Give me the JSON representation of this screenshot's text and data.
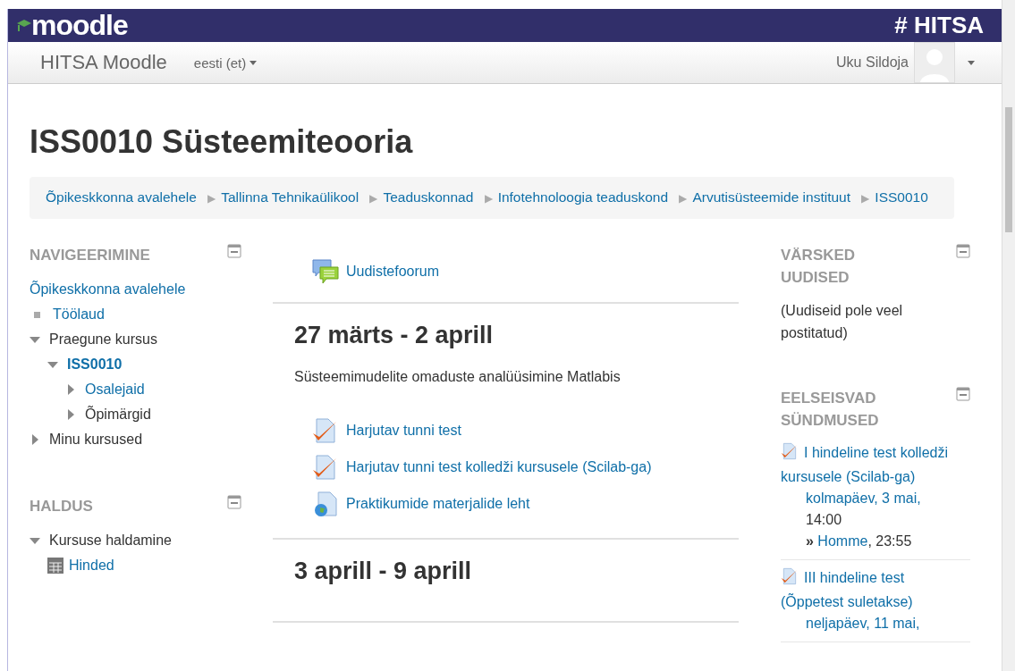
{
  "brand": {
    "logo": "moodle",
    "partner_mark": "#",
    "partner": "HITSA"
  },
  "breadcrumb_separator": "▶",
  "navbar": {
    "site_name": "HITSA Moodle",
    "language": "eesti (et)",
    "user_name": "Uku Sildoja"
  },
  "page_title": "ISS0010 Süsteemiteooria",
  "breadcrumb": [
    "Õpikeskkonna avalehele",
    "Tallinna Tehnikaülikool",
    "Teaduskonnad",
    "Infotehnoloogia teaduskond",
    "Arvutisüsteemide instituut",
    "ISS0010"
  ],
  "left_blocks": [
    {
      "title": "NAVIGEERIMINE",
      "items": [
        {
          "label": "Õpikeskkonna avalehele",
          "kind": "root",
          "link": true
        },
        {
          "label": "Töölaud",
          "kind": "leaf",
          "link": true
        },
        {
          "label": "Praegune kursus",
          "kind": "branch",
          "expanded": true,
          "link": false,
          "children": [
            {
              "label": "ISS0010",
              "kind": "branch",
              "expanded": true,
              "link": true,
              "current": true,
              "children": [
                {
                  "label": "Osalejaid",
                  "kind": "branch",
                  "expanded": false,
                  "link": true
                },
                {
                  "label": "Õpimärgid",
                  "kind": "branch",
                  "expanded": false,
                  "link": false
                }
              ]
            }
          ]
        },
        {
          "label": "Minu kursused",
          "kind": "branch",
          "expanded": false,
          "link": false
        }
      ]
    },
    {
      "title": "HALDUS",
      "items": [
        {
          "label": "Kursuse haldamine",
          "kind": "branch",
          "expanded": true,
          "link": false,
          "children": [
            {
              "label": "Hinded",
              "kind": "grades",
              "link": true
            }
          ]
        }
      ]
    }
  ],
  "sections": [
    {
      "activities": [
        {
          "label": "Uudistefoorum",
          "kind": "forum"
        }
      ]
    },
    {
      "title": "27 märts - 2 aprill",
      "summary": "Süsteemimudelite omaduste analüüsimine Matlabis",
      "activities": [
        {
          "label": "Harjutav tunni test",
          "kind": "quiz"
        },
        {
          "label": "Harjutav tunni test kolledži kursusele (Scilab-ga)",
          "kind": "quiz"
        },
        {
          "label": "Praktikumide materjalide leht",
          "kind": "url"
        }
      ]
    },
    {
      "title": "3 aprill - 9 aprill"
    }
  ],
  "right_blocks": [
    {
      "title": "VÄRSKED UUDISED",
      "kind": "news",
      "text": "(Uudiseid pole veel postitatud)"
    },
    {
      "title": "EELSEISVAD SÜNDMUSED",
      "kind": "events",
      "events": [
        {
          "name": "I hindeline test kolledži kursusele (Scilab-ga)",
          "date_link": "kolmapäev, 3 mai,",
          "date_rest": "14:00",
          "marker": "»",
          "due_link": "Homme",
          "due_rest": ", 23:55"
        },
        {
          "name": "III hindeline test (Õppetest suletakse)",
          "date_link": "neljapäev, 11 mai,"
        }
      ]
    }
  ]
}
